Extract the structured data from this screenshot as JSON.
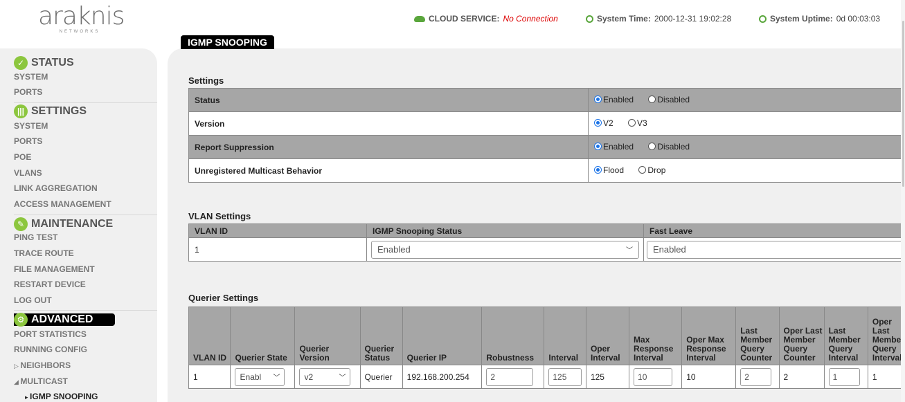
{
  "logo": {
    "word": "araknis",
    "sub": "NETWORKS"
  },
  "header": {
    "cloud_label": "CLOUD SERVICE:",
    "cloud_value": "No Connection",
    "time_label": "System Time:",
    "time_value": "2000-12-31 19:02:28",
    "uptime_label": "System Uptime:",
    "uptime_value": "0d 00:03:03"
  },
  "sidebar": {
    "status": {
      "title": "STATUS",
      "items": [
        "SYSTEM",
        "PORTS"
      ]
    },
    "settings": {
      "title": "SETTINGS",
      "items": [
        "SYSTEM",
        "PORTS",
        "POE",
        "VLANS",
        "LINK AGGREGATION",
        "ACCESS MANAGEMENT"
      ]
    },
    "maintenance": {
      "title": "MAINTENANCE",
      "items": [
        "PING TEST",
        "TRACE ROUTE",
        "FILE MANAGEMENT",
        "RESTART DEVICE",
        "LOG OUT"
      ]
    },
    "advanced": {
      "title": "ADVANCED",
      "items": [
        "PORT STATISTICS",
        "RUNNING CONFIG",
        "NEIGHBORS",
        "MULTICAST",
        "IGMP SNOOPING"
      ]
    }
  },
  "tab": "IGMP SNOOPING",
  "settings": {
    "title": "Settings",
    "rows": [
      {
        "label": "Status",
        "opt1": "Enabled",
        "opt2": "Disabled",
        "selected": 1
      },
      {
        "label": "Version",
        "opt1": "V2",
        "opt2": "V3",
        "selected": 1
      },
      {
        "label": "Report Suppression",
        "opt1": "Enabled",
        "opt2": "Disabled",
        "selected": 1
      },
      {
        "label": "Unregistered Multicast Behavior",
        "opt1": "Flood",
        "opt2": "Drop",
        "selected": 1
      }
    ]
  },
  "vlan": {
    "title": "VLAN Settings",
    "headers": [
      "VLAN ID",
      "IGMP Snooping Status",
      "Fast Leave"
    ],
    "row": {
      "id": "1",
      "status": "Enabled",
      "fast_leave": "Enabled"
    }
  },
  "querier": {
    "title": "Querier Settings",
    "headers": [
      "VLAN ID",
      "Querier State",
      "Querier Version",
      "Querier Status",
      "Querier IP",
      "Robustness",
      "Interval",
      "Oper Interval",
      "Max Response Interval",
      "Oper Max Response Interval",
      "Last Member Query Counter",
      "Oper Last Member Query Counter",
      "Last Member Query Interval",
      "Oper Last Member Query Interval"
    ],
    "row": {
      "id": "1",
      "state": "Enabl",
      "version": "v2",
      "status": "Querier",
      "ip": "192.168.200.254",
      "robustness": "2",
      "interval": "125",
      "oper_interval": "125",
      "max_resp": "10",
      "oper_max_resp": "10",
      "lmq_counter": "2",
      "oper_lmq_counter": "2",
      "lmq_interval": "1",
      "oper_lmq_interval": "1"
    }
  },
  "colors": {
    "accent_green": "#8cc63e",
    "error_red": "#dd0000",
    "header_gray": "#a6a6a6"
  }
}
